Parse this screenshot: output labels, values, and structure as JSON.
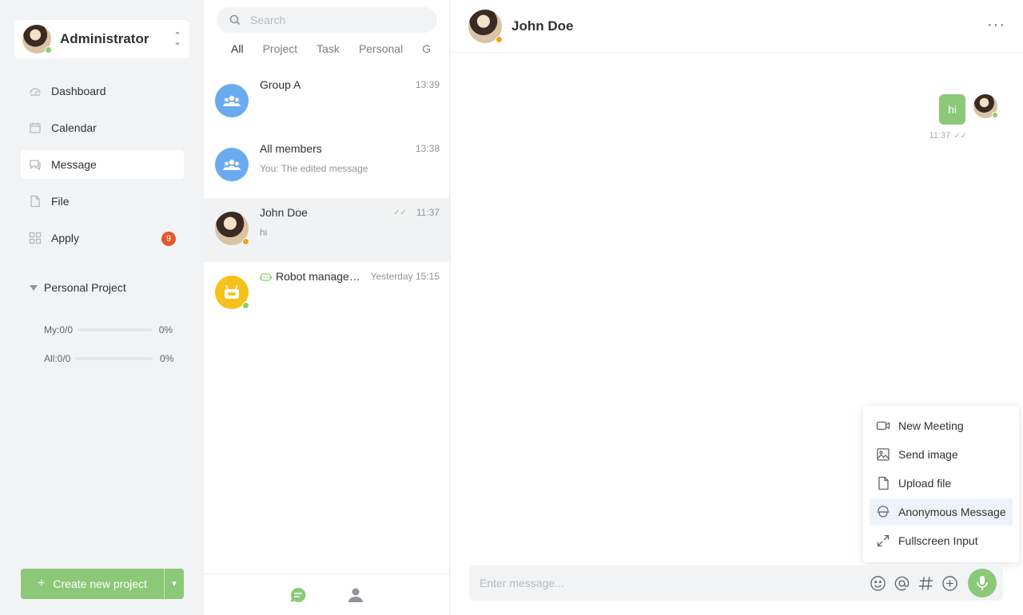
{
  "sidebar": {
    "user": {
      "name": "Administrator"
    },
    "nav": [
      {
        "label": "Dashboard",
        "icon": "dashboard-icon"
      },
      {
        "label": "Calendar",
        "icon": "calendar-icon"
      },
      {
        "label": "Message",
        "icon": "message-icon",
        "active": true
      },
      {
        "label": "File",
        "icon": "file-icon"
      },
      {
        "label": "Apply",
        "icon": "apply-icon",
        "badge": "9"
      }
    ],
    "project_section": {
      "title": "Personal Project",
      "my": {
        "label": "My:",
        "count": "0/0",
        "percent": "0%",
        "progress": 0
      },
      "all": {
        "label": "All:",
        "count": "0/0",
        "percent": "0%",
        "progress": 0
      }
    },
    "create_button": {
      "label": "Create new project"
    }
  },
  "conversations": {
    "search_placeholder": "Search",
    "tabs": [
      "All",
      "Project",
      "Task",
      "Personal",
      "G"
    ],
    "items": [
      {
        "name": "Group A",
        "time": "13:39",
        "preview": ""
      },
      {
        "name": "All members",
        "time": "13:38",
        "preview": "You: The edited message"
      },
      {
        "name": "John Doe",
        "time": "11:37",
        "preview": "hi"
      },
      {
        "name": "Robot manage…",
        "time": "Yesterday 15:15",
        "preview": ""
      }
    ]
  },
  "chat": {
    "title": "John Doe",
    "message": {
      "text": "hi",
      "time": "11:37"
    },
    "input_placeholder": "Enter message...",
    "popup_menu": [
      {
        "label": "New Meeting",
        "icon": "video-icon"
      },
      {
        "label": "Send image",
        "icon": "image-icon"
      },
      {
        "label": "Upload file",
        "icon": "file-icon"
      },
      {
        "label": "Anonymous Message",
        "icon": "anonymous-icon",
        "active": true
      },
      {
        "label": "Fullscreen Input",
        "icon": "fullscreen-icon"
      }
    ]
  },
  "colors": {
    "accent_green": "#8bc878",
    "group_blue": "#6aaaf0",
    "robot_yellow": "#f5c21b",
    "badge_red": "#e4572e"
  }
}
